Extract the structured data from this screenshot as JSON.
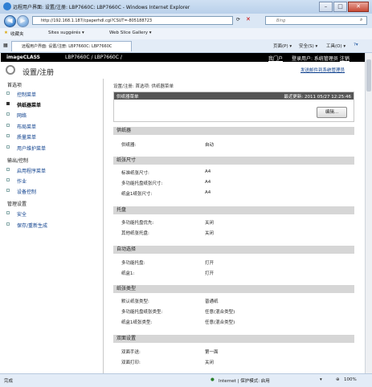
{
  "window": {
    "title": "远程用户界面: 设置/注册: LBP7660C: LBP7660C - Windows Internet Explorer"
  },
  "address_bar": {
    "url": "http://192.168.1.187/cpaperhdl.cgi?CSUT=-805188723",
    "search_placeholder": "Bing"
  },
  "favorites_bar": {
    "favorites_label": "收藏夹",
    "sites_label": "Sites suggérés ▾",
    "webslice_label": "Web Slice Gallery ▾"
  },
  "tab": {
    "label": "远程用户界面: 设置/注册: LBP7660C: LBP7660C"
  },
  "command_bar": {
    "page_label": "页面(P) ▾",
    "safety_label": "安全(S) ▾",
    "tools_label": "工具(O) ▾"
  },
  "page_header": {
    "brand": "imageCLASS",
    "model": "LBP7660C / LBP7660C /",
    "my_page": "我门户",
    "login_text": "登录用户: 系统管理员",
    "logout": "注销"
  },
  "subheader": {
    "title": "设置/注册",
    "send_mail": "发送邮件到系统管理员"
  },
  "sidebar": {
    "groups": [
      {
        "title": "首选项",
        "items": [
          "控制菜单",
          "供纸器菜单",
          "网络",
          "布局菜单",
          "质量菜单",
          "用户维护菜单"
        ]
      },
      {
        "title": "输出/控制",
        "items": [
          "启用程序菜单",
          "作业",
          "设备控制"
        ]
      },
      {
        "title": "管理设置",
        "items": [
          "安全",
          "保存/重新生成"
        ]
      }
    ],
    "active": "供纸器菜单"
  },
  "main": {
    "breadcrumb": "设置/注册: 首选项: 供纸器菜单",
    "menu_title": "供纸器菜单",
    "last_updated": "最近更新: 2011 05/27 12:25:46",
    "edit_button": "编辑...",
    "sections": [
      {
        "title": "供纸器",
        "rows": [
          {
            "label": "供纸器:",
            "value": "自动"
          }
        ]
      },
      {
        "title": "纸张尺寸",
        "rows": [
          {
            "label": "标准纸张尺寸:",
            "value": "A4"
          },
          {
            "label": "多功能托盘纸张尺寸:",
            "value": "A4"
          },
          {
            "label": "纸盒1纸张尺寸:",
            "value": "A4"
          }
        ]
      },
      {
        "title": "托盘",
        "rows": [
          {
            "label": "多功能托盘优先:",
            "value": "关闭"
          },
          {
            "label": "其他纸张托盘:",
            "value": "关闭"
          }
        ]
      },
      {
        "title": "自动选择",
        "rows": [
          {
            "label": "多功能托盘:",
            "value": "打开"
          },
          {
            "label": "纸盒1:",
            "value": "打开"
          }
        ]
      },
      {
        "title": "纸张类型",
        "rows": [
          {
            "label": "默认纸张类型:",
            "value": "普通纸"
          },
          {
            "label": "多功能托盘纸张类型:",
            "value": "任意(混合类型)"
          },
          {
            "label": "纸盒1纸张类型:",
            "value": "任意(混合类型)"
          }
        ]
      },
      {
        "title": "双面设置",
        "rows": [
          {
            "label": "双面手送:",
            "value": "第一面"
          },
          {
            "label": "双面打印:",
            "value": "关闭"
          }
        ]
      }
    ]
  },
  "status_bar": {
    "left": "完成",
    "zone": "Internet | 保护模式: 启用",
    "zoom": "100%"
  }
}
